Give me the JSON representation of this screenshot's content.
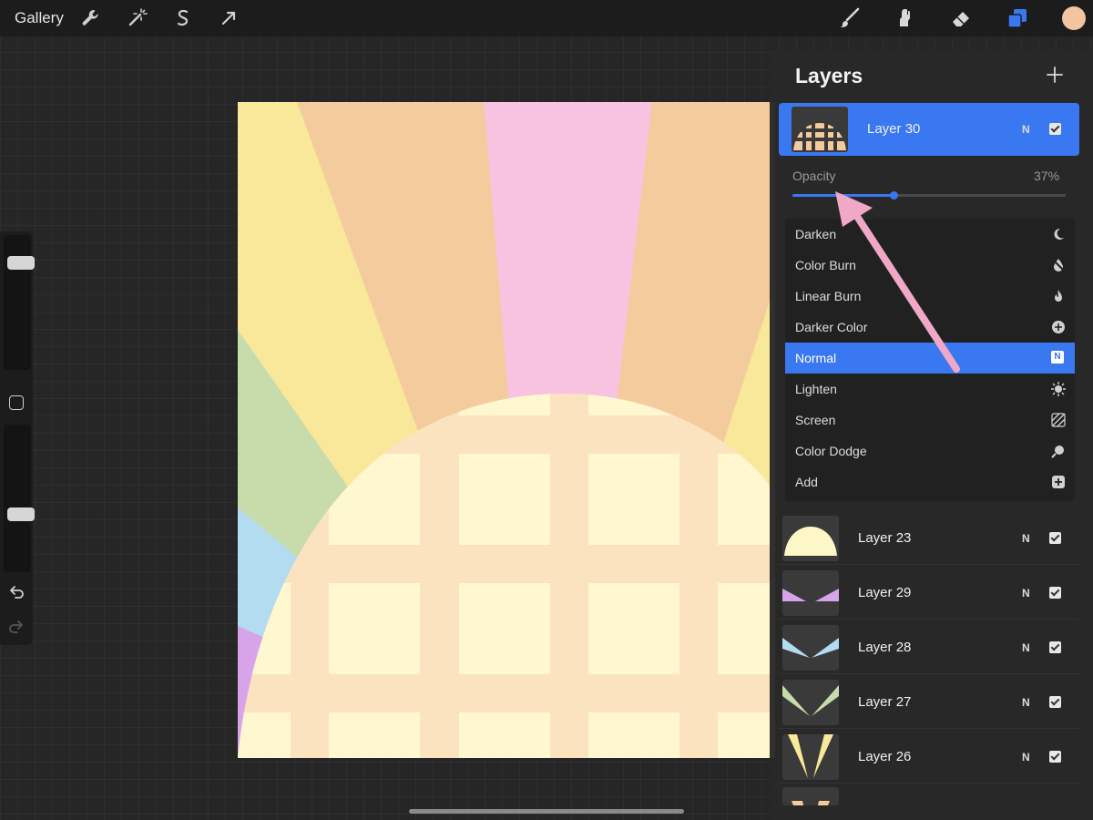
{
  "toolbar": {
    "gallery_label": "Gallery",
    "left_tools": [
      "wrench-icon",
      "magic-wand-icon",
      "selection-icon",
      "transform-arrow-icon"
    ],
    "right_tools": [
      "brush-icon",
      "smudge-icon",
      "eraser-icon",
      "layers-icon",
      "color-swatch"
    ],
    "active_color": "#f2c4a0",
    "accent_color": "#3a78f2"
  },
  "sidebar": {
    "brush_size": 0.83,
    "brush_opacity": 0.38
  },
  "layers_panel": {
    "title": "Layers",
    "active_layer": {
      "name": "Layer 30",
      "mode": "N",
      "visible": true
    },
    "opacity": {
      "label": "Opacity",
      "value_text": "37%",
      "value": 0.37
    },
    "blend_modes": [
      {
        "label": "Darken",
        "icon": "moon-icon"
      },
      {
        "label": "Color Burn",
        "icon": "burn-drop-icon"
      },
      {
        "label": "Linear Burn",
        "icon": "flame-icon"
      },
      {
        "label": "Darker Color",
        "icon": "plus-circle-icon"
      },
      {
        "label": "Normal",
        "icon": "n-badge-icon",
        "selected": true
      },
      {
        "label": "Lighten",
        "icon": "sun-icon"
      },
      {
        "label": "Screen",
        "icon": "hatch-icon"
      },
      {
        "label": "Color Dodge",
        "icon": "dodge-icon"
      },
      {
        "label": "Add",
        "icon": "plus-square-icon"
      }
    ],
    "selected_mode_badge": "N",
    "layers": [
      {
        "name": "Layer 23",
        "mode": "N",
        "visible": true
      },
      {
        "name": "Layer 29",
        "mode": "N",
        "visible": true
      },
      {
        "name": "Layer 28",
        "mode": "N",
        "visible": true
      },
      {
        "name": "Layer 27",
        "mode": "N",
        "visible": true
      },
      {
        "name": "Layer 26",
        "mode": "N",
        "visible": true
      }
    ]
  }
}
